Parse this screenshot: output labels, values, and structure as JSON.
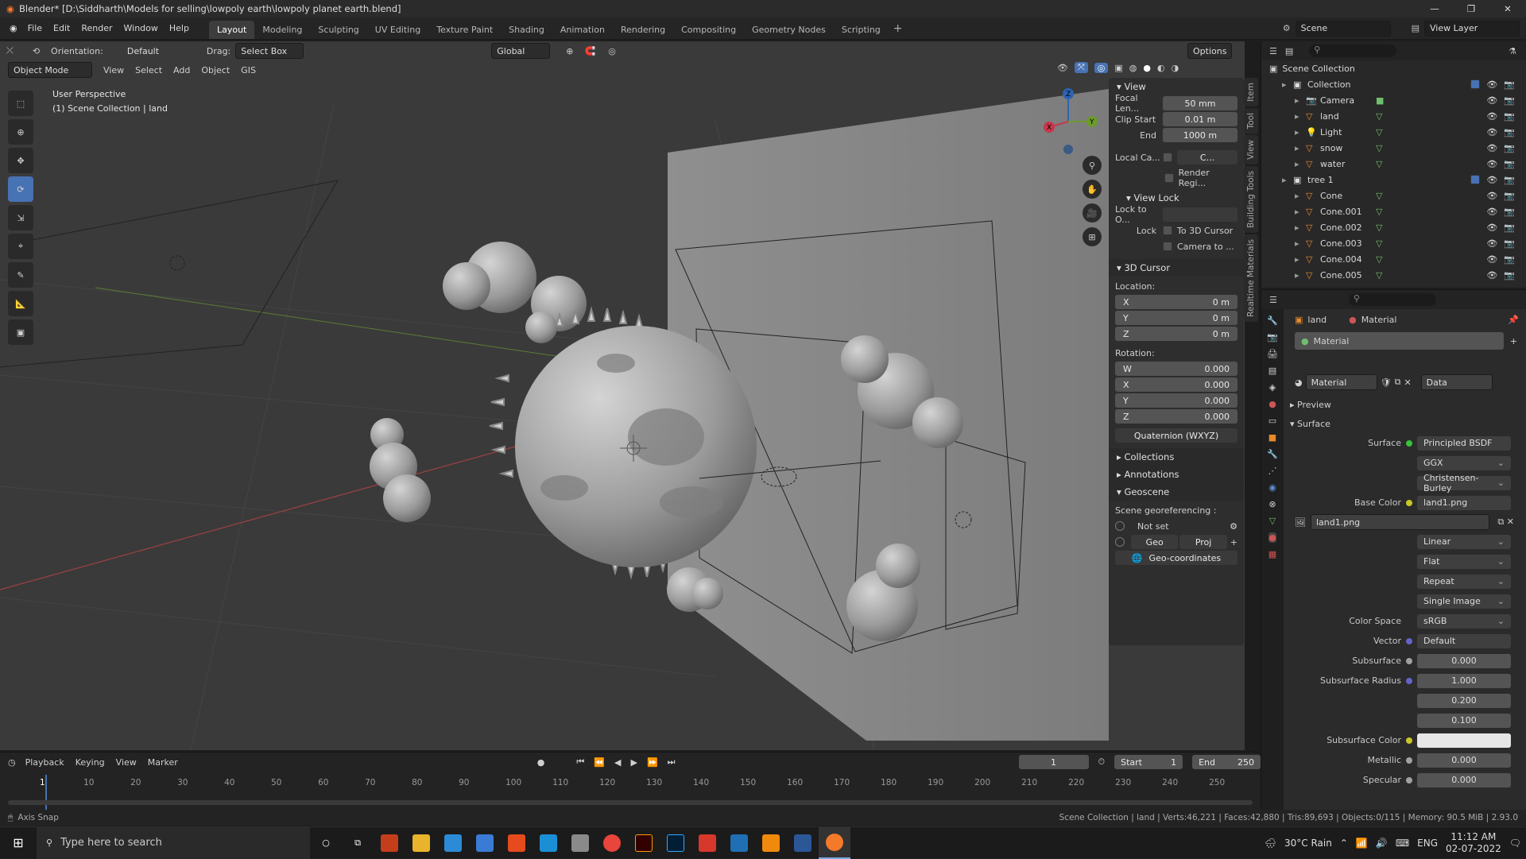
{
  "window": {
    "title": "Blender* [D:\\Siddharth\\Models for selling\\lowpoly earth\\lowpoly planet earth.blend]",
    "min": "—",
    "max": "❐",
    "close": "✕"
  },
  "menu": {
    "items": [
      "File",
      "Edit",
      "Render",
      "Window",
      "Help"
    ],
    "workspaces": [
      "Layout",
      "Modeling",
      "Sculpting",
      "UV Editing",
      "Texture Paint",
      "Shading",
      "Animation",
      "Rendering",
      "Compositing",
      "Geometry Nodes",
      "Scripting"
    ],
    "scene": "Scene",
    "view_layer": "View Layer"
  },
  "toolheader": {
    "orientation_label": "Orientation:",
    "orientation": "Default",
    "drag_label": "Drag:",
    "drag": "Select Box",
    "transform": "Global",
    "options": "Options"
  },
  "viewheader": {
    "mode": "Object Mode",
    "items": [
      "View",
      "Select",
      "Add",
      "Object",
      "GIS"
    ]
  },
  "viewport": {
    "perspective": "User Perspective",
    "collection": "(1) Scene Collection | land",
    "gizmo": {
      "x": "X",
      "y": "Y",
      "z": "Z"
    }
  },
  "npanel": {
    "view_title": "View",
    "focal_label": "Focal Len...",
    "focal": "50 mm",
    "clip_start_label": "Clip Start",
    "clip_start": "0.01 m",
    "end_label": "End",
    "end": "1000 m",
    "local_cam_label": "Local Ca...",
    "local_cam": "C...",
    "render_region": "Render Regi...",
    "view_lock": "View Lock",
    "lock_to_label": "Lock to O...",
    "lock_label": "Lock",
    "to_cursor": "To 3D Cursor",
    "camera_to": "Camera to ...",
    "cursor_title": "3D Cursor",
    "location_label": "Location:",
    "loc": [
      {
        "axis": "X",
        "value": "0 m"
      },
      {
        "axis": "Y",
        "value": "0 m"
      },
      {
        "axis": "Z",
        "value": "0 m"
      }
    ],
    "rotation_label": "Rotation:",
    "rot": [
      {
        "axis": "W",
        "value": "0.000"
      },
      {
        "axis": "X",
        "value": "0.000"
      },
      {
        "axis": "Y",
        "value": "0.000"
      },
      {
        "axis": "Z",
        "value": "0.000"
      }
    ],
    "rot_mode": "Quaternion (WXYZ)",
    "collections": "Collections",
    "annotations": "Annotations",
    "geoscene": "Geoscene",
    "georef": "Scene georeferencing :",
    "not_set": "Not set",
    "geo": "Geo",
    "proj": "Proj",
    "geocoords": "Geo-coordinates"
  },
  "sidetabs": [
    "Item",
    "Tool",
    "View",
    "Building Tools",
    "Realtime Materials"
  ],
  "outliner": {
    "root": "Scene Collection",
    "rows": [
      {
        "name": "Collection",
        "indent": 1,
        "kind": "coll"
      },
      {
        "name": "Camera",
        "indent": 2,
        "kind": "cam"
      },
      {
        "name": "land",
        "indent": 2,
        "kind": "mesh"
      },
      {
        "name": "Light",
        "indent": 2,
        "kind": "light"
      },
      {
        "name": "snow",
        "indent": 2,
        "kind": "mesh"
      },
      {
        "name": "water",
        "indent": 2,
        "kind": "mesh"
      },
      {
        "name": "tree 1",
        "indent": 1,
        "kind": "coll"
      },
      {
        "name": "Cone",
        "indent": 2,
        "kind": "mesh"
      },
      {
        "name": "Cone.001",
        "indent": 2,
        "kind": "mesh"
      },
      {
        "name": "Cone.002",
        "indent": 2,
        "kind": "mesh"
      },
      {
        "name": "Cone.003",
        "indent": 2,
        "kind": "mesh"
      },
      {
        "name": "Cone.004",
        "indent": 2,
        "kind": "mesh"
      },
      {
        "name": "Cone.005",
        "indent": 2,
        "kind": "mesh"
      }
    ]
  },
  "props": {
    "breadcrumb_obj": "land",
    "breadcrumb_mat": "Material",
    "slot": "Material",
    "mat_name": "Material",
    "data": "Data",
    "preview": "Preview",
    "surface_section": "Surface",
    "rows": [
      {
        "label": "Surface",
        "value": "Principled BSDF",
        "dot": "#38c23a",
        "kind": "socket"
      },
      {
        "label": "",
        "value": "GGX",
        "kind": "drop"
      },
      {
        "label": "",
        "value": "Christensen-Burley",
        "kind": "drop"
      },
      {
        "label": "Base Color",
        "value": "land1.png",
        "dot": "#c7c729",
        "kind": "socket"
      }
    ],
    "image": "land1.png",
    "img_rows": [
      "Linear",
      "Flat",
      "Repeat",
      "Single Image"
    ],
    "rows2": [
      {
        "label": "Color Space",
        "value": "sRGB",
        "kind": "drop"
      },
      {
        "label": "Vector",
        "value": "Default",
        "dot": "#6363c7",
        "kind": "socket"
      },
      {
        "label": "Subsurface",
        "value": "0.000",
        "dot": "#a1a1a1",
        "kind": "num"
      },
      {
        "label": "Subsurface Radius",
        "value": "1.000",
        "dot": "#6363c7",
        "kind": "num"
      },
      {
        "label": "",
        "value": "0.200",
        "kind": "num"
      },
      {
        "label": "",
        "value": "0.100",
        "kind": "num"
      },
      {
        "label": "Subsurface Color",
        "value": "",
        "dot": "#c7c729",
        "kind": "color"
      },
      {
        "label": "Metallic",
        "value": "0.000",
        "dot": "#a1a1a1",
        "kind": "num"
      },
      {
        "label": "Specular",
        "value": "0.000",
        "dot": "#a1a1a1",
        "kind": "num"
      }
    ]
  },
  "timeline": {
    "items": [
      "Playback",
      "Keying",
      "View",
      "Marker"
    ],
    "frame": "1",
    "start_label": "Start",
    "start": "1",
    "end_label": "End",
    "end": "250",
    "ticks": [
      "1",
      "10",
      "20",
      "30",
      "40",
      "50",
      "60",
      "70",
      "80",
      "90",
      "100",
      "110",
      "120",
      "130",
      "140",
      "150",
      "160",
      "170",
      "180",
      "190",
      "200",
      "210",
      "220",
      "230",
      "240",
      "250"
    ]
  },
  "status": {
    "left": "Axis Snap",
    "right": "Scene Collection | land | Verts:46,221 | Faces:42,880 | Tris:89,693 | Objects:0/115 | Memory: 90.5 MiB | 2.93.0"
  },
  "taskbar": {
    "search": "Type here to search",
    "weather": "30°C  Rain",
    "lang": "ENG",
    "time": "11:12 AM",
    "date": "02-07-2022"
  }
}
